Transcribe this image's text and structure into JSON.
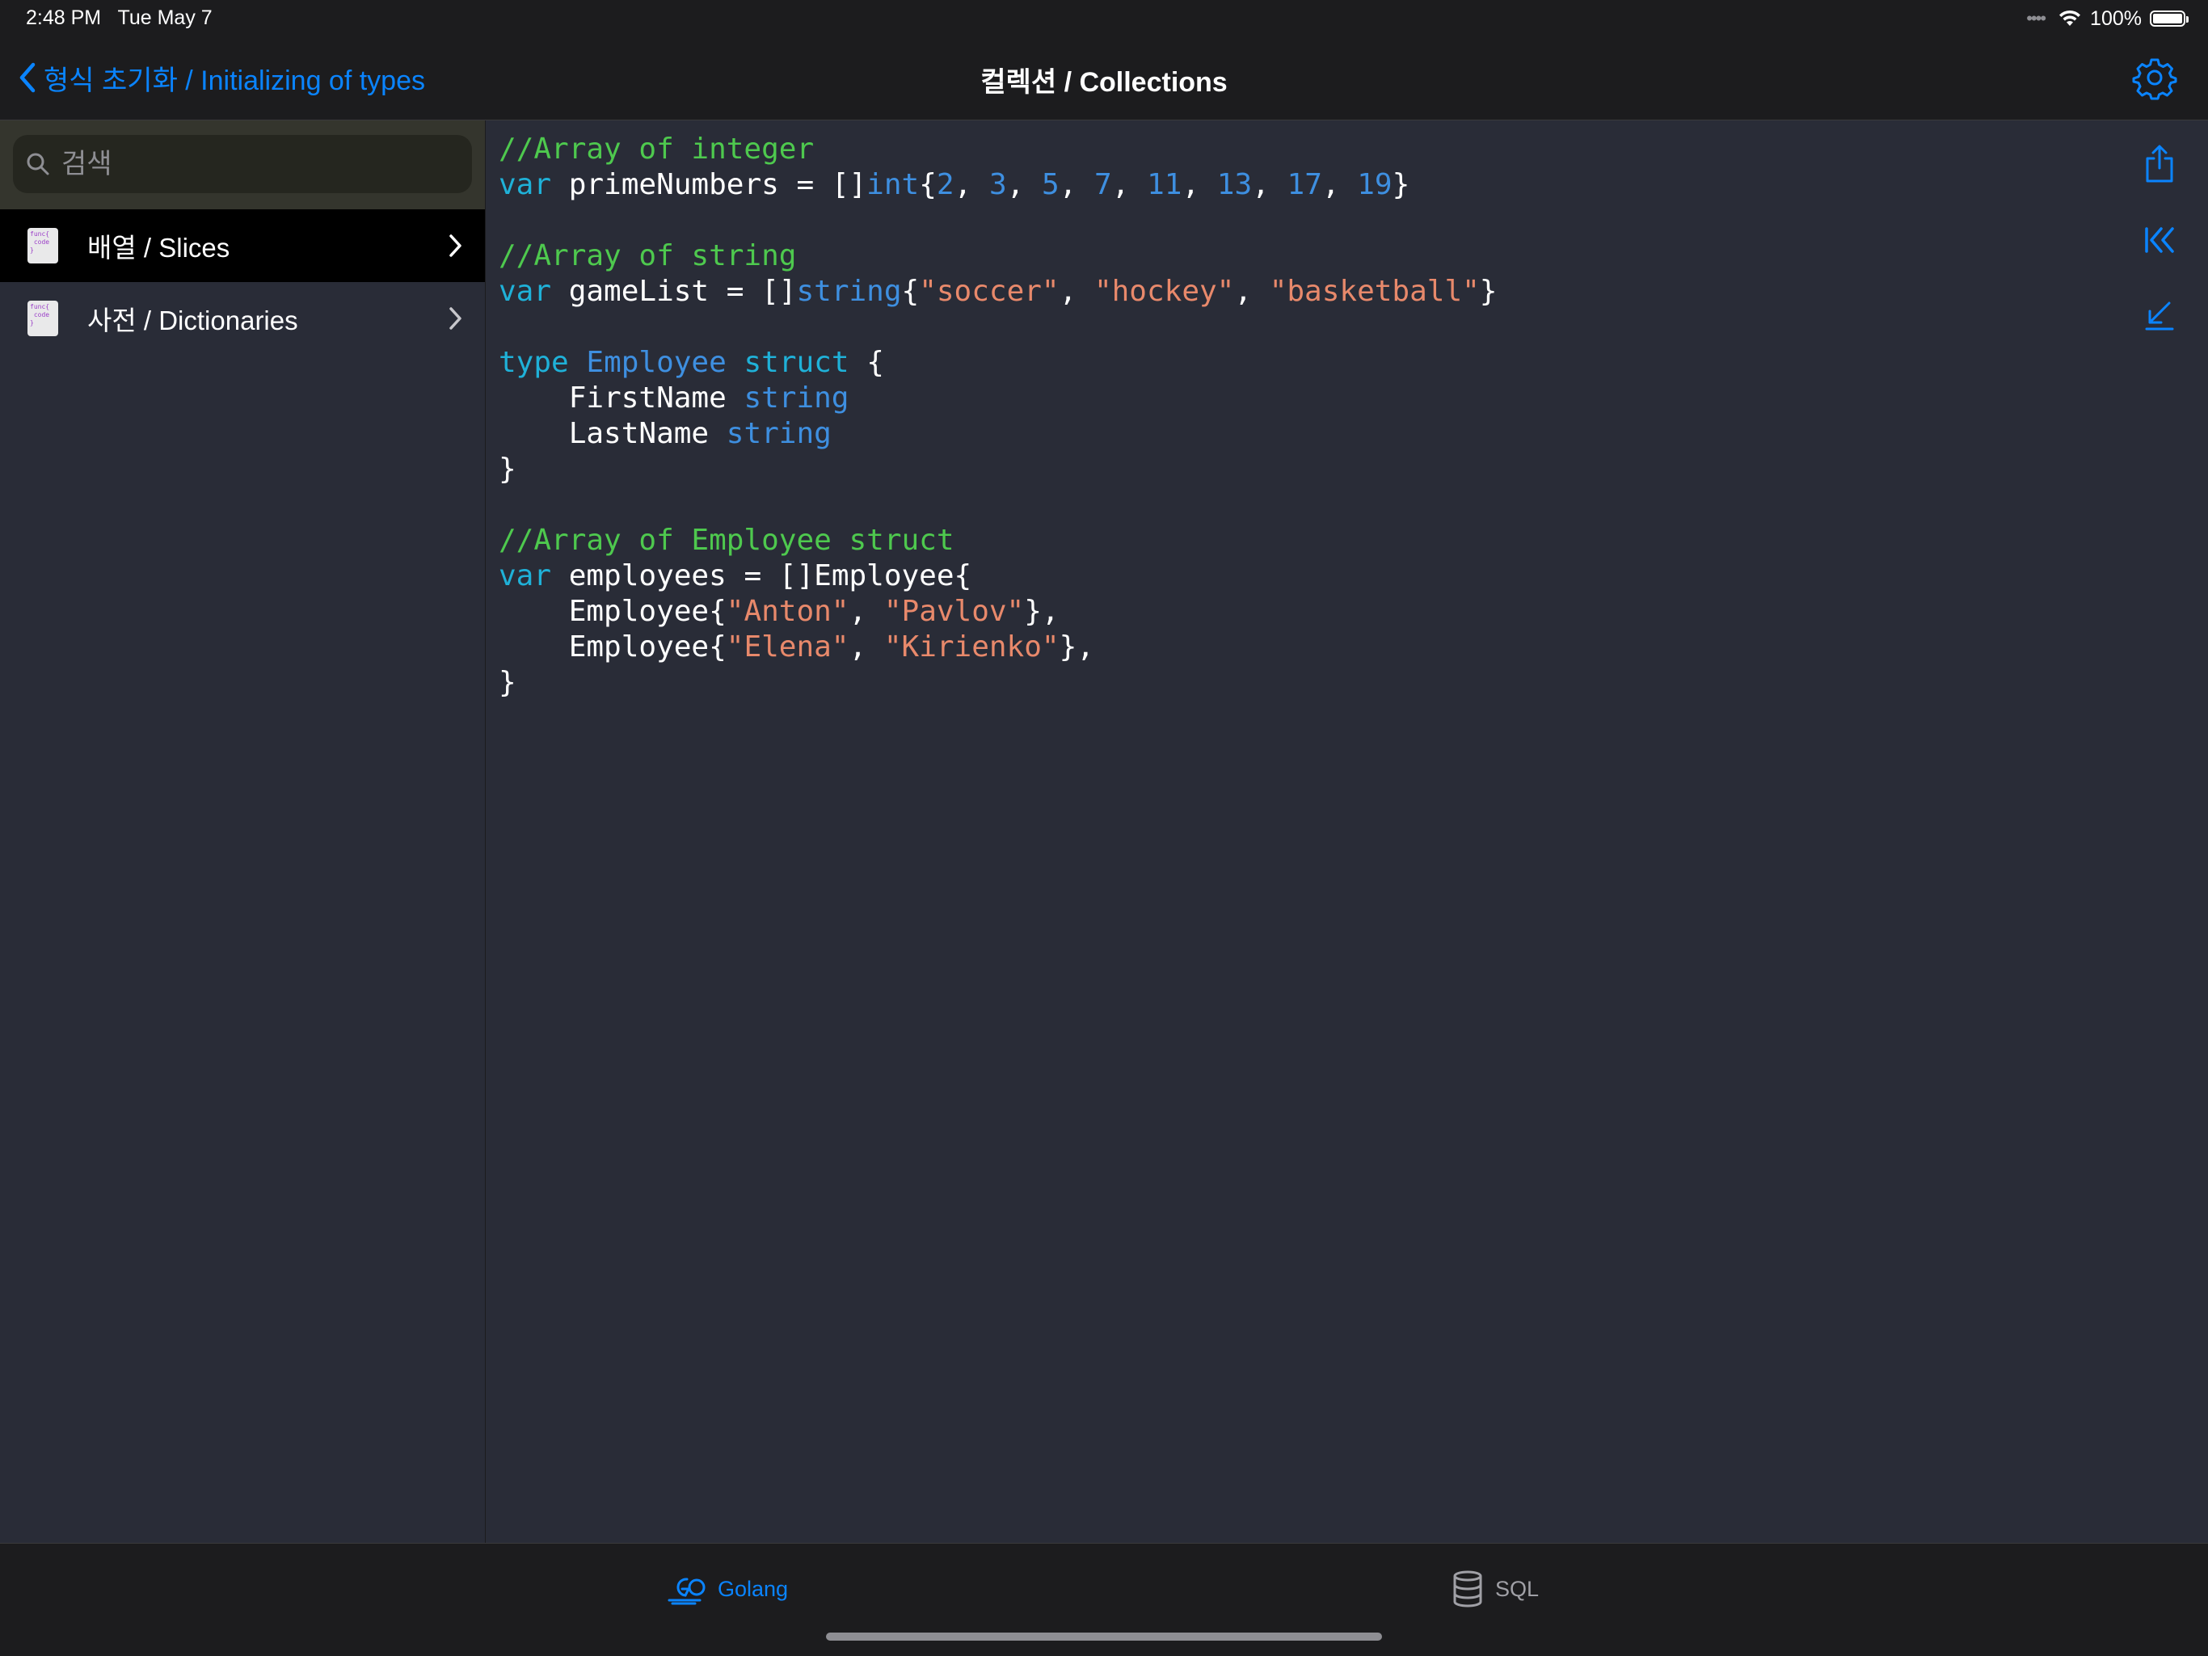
{
  "status_bar": {
    "time": "2:48 PM",
    "date": "Tue May 7",
    "battery": "100%"
  },
  "nav": {
    "back_label": "형식 초기화 / Initializing of types",
    "title": "컬렉션 / Collections"
  },
  "sidebar": {
    "search_placeholder": "검색",
    "items": [
      {
        "label": "배열 / Slices",
        "selected": true,
        "icon": "code-file-icon"
      },
      {
        "label": "사전 / Dictionaries",
        "selected": false,
        "icon": "code-file-icon"
      }
    ]
  },
  "code": {
    "l1": "//Array of integer",
    "l2_kw": "var",
    "l2_a": " primeNumbers = []",
    "l2_type": "int",
    "l2_b": "{",
    "n1": "2",
    "n2": "3",
    "n3": "5",
    "n4": "7",
    "n5": "11",
    "n6": "13",
    "n7": "17",
    "n8": "19",
    "sep": ", ",
    "close": "}",
    "l4": "//Array of string",
    "l5_kw": "var",
    "l5_a": " gameList = []",
    "l5_type": "string",
    "l5_b": "{",
    "s1": "\"soccer\"",
    "s2": "\"hockey\"",
    "s3": "\"basketball\"",
    "l7_kw1": "type",
    "l7_name": "Employee",
    "l7_kw2": "struct",
    "l7_b": " {",
    "l8_a": "    FirstName ",
    "l8_type": "string",
    "l9_a": "    LastName ",
    "l9_type": "string",
    "l10": "}",
    "l12": "//Array of Employee struct",
    "l13_kw": "var",
    "l13_a": " employees = []Employee{",
    "l14_a": "    Employee{",
    "l14_s1": "\"Anton\"",
    "l14_s2": "\"Pavlov\"",
    "l14_b": "},",
    "l15_a": "    Employee{",
    "l15_s1": "\"Elena\"",
    "l15_s2": "\"Kirienko\"",
    "l15_b": "},",
    "l16": "}"
  },
  "tools": [
    "share-icon",
    "jump-to-start-icon",
    "download-arrow-icon"
  ],
  "tabs": [
    {
      "label": "Golang",
      "icon": "go-logo-icon",
      "active": true
    },
    {
      "label": "SQL",
      "icon": "database-icon",
      "active": false
    }
  ],
  "colors": {
    "accent": "#0a84ff",
    "comment": "#4ec94e",
    "keyword": "#1fb1d8",
    "type": "#3e8fe0",
    "string": "#e8896b",
    "background": "#292c37"
  }
}
